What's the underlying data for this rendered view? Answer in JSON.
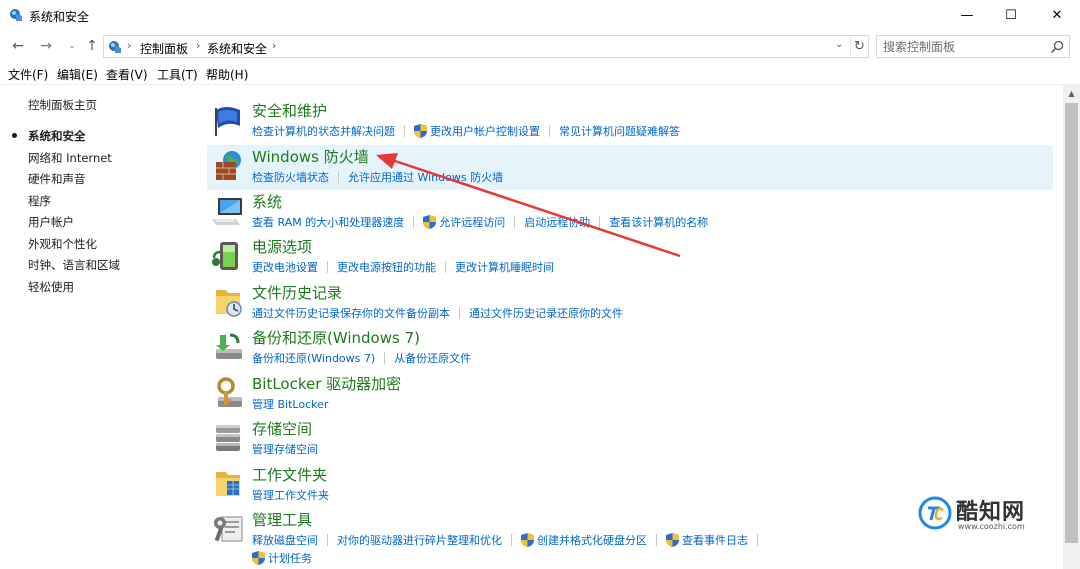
{
  "window": {
    "title": "系统和安全",
    "minimize": "—",
    "maximize": "☐",
    "close": "✕"
  },
  "nav": {
    "back": "←",
    "forward": "→",
    "recent": "⌄",
    "up": "↑",
    "breadcrumbs": [
      "控制面板",
      "系统和安全"
    ],
    "crumb_sep": "›",
    "dropdown": "⌄",
    "refresh": "↻"
  },
  "search": {
    "placeholder": "搜索控制面板"
  },
  "menu": [
    "文件(F)",
    "编辑(E)",
    "查看(V)",
    "工具(T)",
    "帮助(H)"
  ],
  "sidebar": {
    "items": [
      {
        "label": "控制面板主页"
      },
      {
        "label": "系统和安全",
        "current": true
      },
      {
        "label": "网络和 Internet"
      },
      {
        "label": "硬件和声音"
      },
      {
        "label": "程序"
      },
      {
        "label": "用户帐户"
      },
      {
        "label": "外观和个性化"
      },
      {
        "label": "时钟、语言和区域"
      },
      {
        "label": "轻松使用"
      }
    ]
  },
  "categories": [
    {
      "title": "安全和维护",
      "icon": "flag-icon",
      "links": [
        {
          "label": "检查计算机的状态并解决问题",
          "shield": false
        },
        {
          "label": "更改用户帐户控制设置",
          "shield": true
        },
        {
          "label": "常见计算机问题疑难解答",
          "shield": false
        }
      ]
    },
    {
      "title": "Windows 防火墙",
      "icon": "firewall-icon",
      "highlighted": true,
      "links": [
        {
          "label": "检查防火墙状态",
          "shield": false
        },
        {
          "label": "允许应用通过 Windows 防火墙",
          "shield": false
        }
      ]
    },
    {
      "title": "系统",
      "icon": "computer-icon",
      "links": [
        {
          "label": "查看 RAM 的大小和处理器速度",
          "shield": false
        },
        {
          "label": "允许远程访问",
          "shield": true
        },
        {
          "label": "启动远程协助",
          "shield": false
        },
        {
          "label": "查看该计算机的名称",
          "shield": false
        }
      ]
    },
    {
      "title": "电源选项",
      "icon": "battery-icon",
      "links": [
        {
          "label": "更改电池设置",
          "shield": false
        },
        {
          "label": "更改电源按钮的功能",
          "shield": false
        },
        {
          "label": "更改计算机睡眠时间",
          "shield": false
        }
      ]
    },
    {
      "title": "文件历史记录",
      "icon": "file-history-icon",
      "links": [
        {
          "label": "通过文件历史记录保存你的文件备份副本",
          "shield": false
        },
        {
          "label": "通过文件历史记录还原你的文件",
          "shield": false
        }
      ]
    },
    {
      "title": "备份和还原(Windows 7)",
      "icon": "backup-icon",
      "links": [
        {
          "label": "备份和还原(Windows 7)",
          "shield": false
        },
        {
          "label": "从备份还原文件",
          "shield": false
        }
      ]
    },
    {
      "title": "BitLocker 驱动器加密",
      "icon": "bitlocker-icon",
      "links": [
        {
          "label": "管理 BitLocker",
          "shield": false
        }
      ]
    },
    {
      "title": "存储空间",
      "icon": "storage-icon",
      "links": [
        {
          "label": "管理存储空间",
          "shield": false
        }
      ]
    },
    {
      "title": "工作文件夹",
      "icon": "work-folders-icon",
      "links": [
        {
          "label": "管理工作文件夹",
          "shield": false
        }
      ]
    },
    {
      "title": "管理工具",
      "icon": "admin-tools-icon",
      "links": [
        {
          "label": "释放磁盘空间",
          "shield": false
        },
        {
          "label": "对你的驱动器进行碎片整理和优化",
          "shield": false
        },
        {
          "label": "创建并格式化硬盘分区",
          "shield": true
        },
        {
          "label": "查看事件日志",
          "shield": true
        }
      ],
      "links_line2": [
        {
          "label": "计划任务",
          "shield": true
        }
      ]
    }
  ],
  "watermark": {
    "name": "酷知网",
    "url": "www.coozhi.com"
  },
  "colors": {
    "category_title": "#1e7b1e",
    "link": "#0066cc",
    "highlight": "#e5f3fb",
    "arrow": "#e53935"
  }
}
